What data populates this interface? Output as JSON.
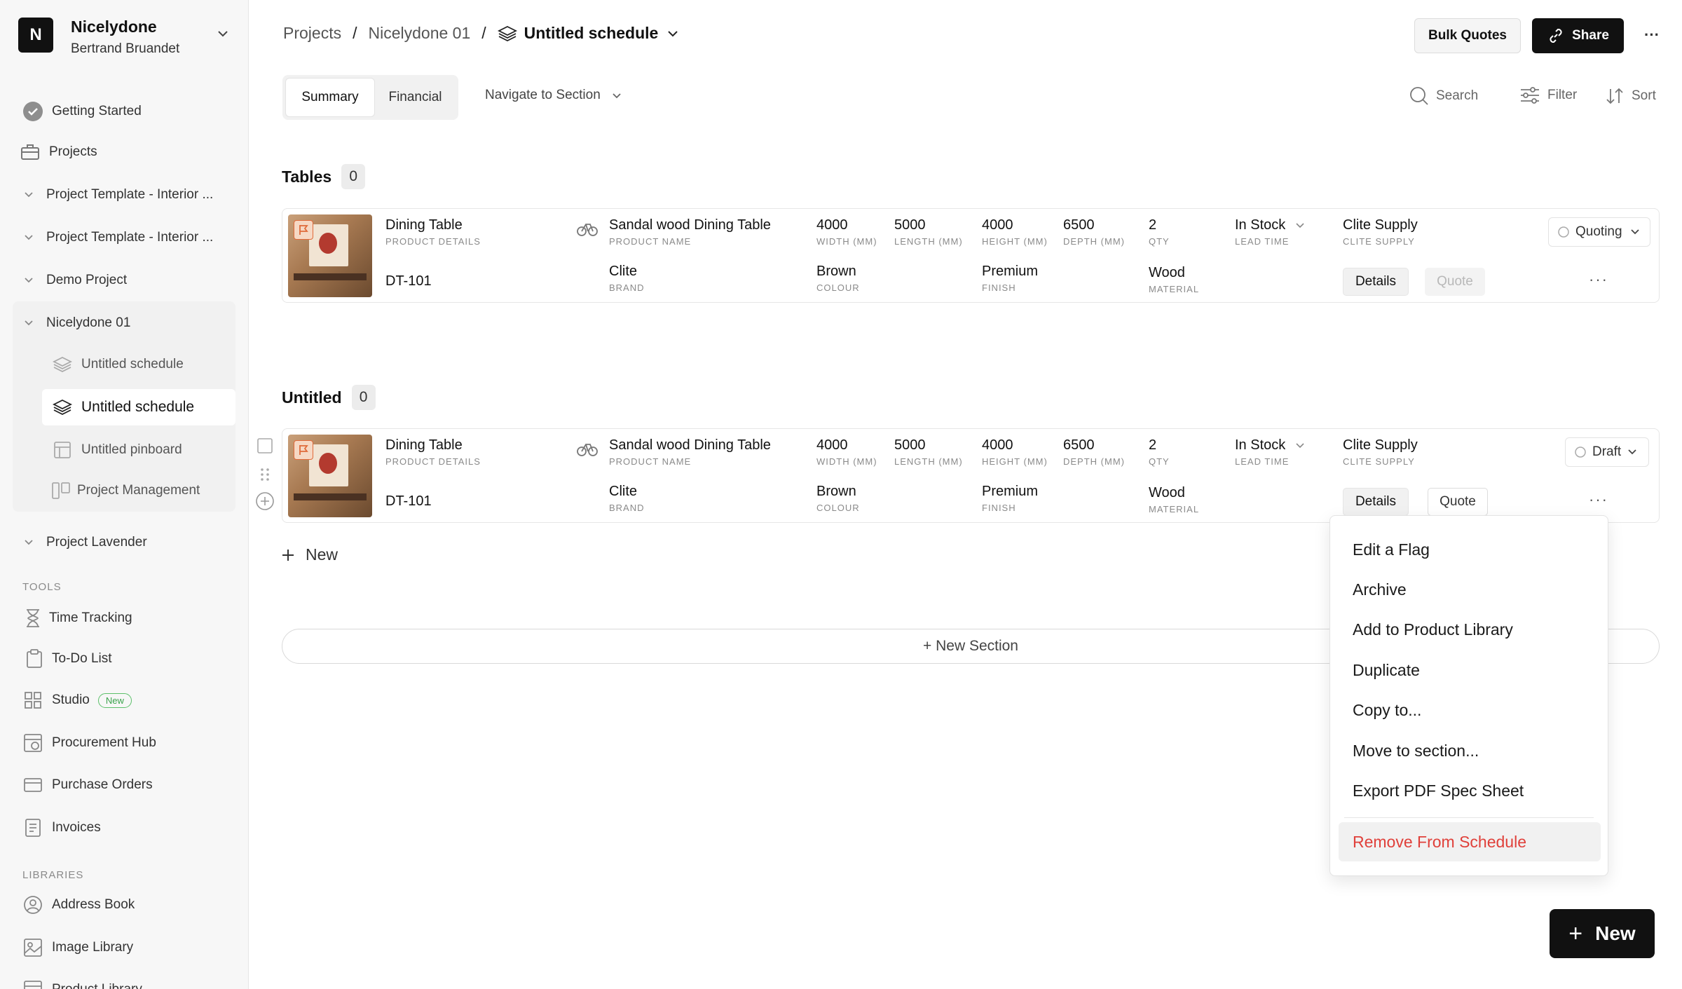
{
  "workspace": {
    "initial": "N",
    "name": "Nicelydone",
    "user": "Bertrand Bruandet"
  },
  "sidebar": {
    "items": [
      {
        "label": "Getting Started"
      },
      {
        "label": "Projects"
      },
      {
        "label": "Project Template - Interior ..."
      },
      {
        "label": "Project Template - Interior ..."
      },
      {
        "label": "Demo Project"
      },
      {
        "label": "Nicelydone 01"
      },
      {
        "label": "Untitled schedule"
      },
      {
        "label": "Untitled schedule"
      },
      {
        "label": "Untitled pinboard"
      },
      {
        "label": "Project Management"
      },
      {
        "label": "Project Lavender"
      }
    ],
    "tools_label": "TOOLS",
    "tools": [
      {
        "label": "Time Tracking"
      },
      {
        "label": "To-Do List"
      },
      {
        "label": "Studio",
        "badge": "New"
      },
      {
        "label": "Procurement Hub"
      },
      {
        "label": "Purchase Orders"
      },
      {
        "label": "Invoices"
      }
    ],
    "libraries_label": "LIBRARIES",
    "libraries": [
      {
        "label": "Address Book"
      },
      {
        "label": "Image Library"
      },
      {
        "label": "Product Library"
      }
    ]
  },
  "breadcrumb": {
    "projects": "Projects",
    "project": "Nicelydone 01",
    "current": "Untitled schedule",
    "sep": "/"
  },
  "header": {
    "bulk_quotes": "Bulk Quotes",
    "share": "Share",
    "more": "···"
  },
  "tabs": [
    {
      "label": "Summary"
    },
    {
      "label": "Financial"
    }
  ],
  "navigate": "Navigate to Section",
  "toolbar": {
    "search": "Search",
    "filter": "Filter",
    "sort": "Sort"
  },
  "sections": [
    {
      "title": "Tables",
      "count": "0",
      "row": {
        "name": "Dining Table",
        "name_lbl": "PRODUCT DETAILS",
        "code": "DT-101",
        "product": "Sandal wood Dining Table",
        "product_lbl": "PRODUCT NAME",
        "brand": "Clite",
        "brand_lbl": "BRAND",
        "width": "4000",
        "width_lbl": "WIDTH (MM)",
        "colour": "Brown",
        "colour_lbl": "COLOUR",
        "length": "5000",
        "length_lbl": "LENGTH (MM)",
        "height": "4000",
        "height_lbl": "HEIGHT (MM)",
        "finish": "Premium",
        "finish_lbl": "FINISH",
        "depth": "6500",
        "depth_lbl": "DEPTH (MM)",
        "qty": "2",
        "qty_lbl": "QTY",
        "material": "Wood",
        "material_lbl": "MATERIAL",
        "lead": "In Stock",
        "lead_lbl": "LEAD TIME",
        "supplier": "Clite Supply",
        "supplier_lbl": "CLITE SUPPLY",
        "status": "Quoting",
        "details": "Details",
        "quote": "Quote",
        "more": "···"
      }
    },
    {
      "title": "Untitled",
      "count": "0",
      "row": {
        "name": "Dining Table",
        "name_lbl": "PRODUCT DETAILS",
        "code": "DT-101",
        "product": "Sandal wood Dining Table",
        "product_lbl": "PRODUCT NAME",
        "brand": "Clite",
        "brand_lbl": "BRAND",
        "width": "4000",
        "width_lbl": "WIDTH (MM)",
        "colour": "Brown",
        "colour_lbl": "COLOUR",
        "length": "5000",
        "length_lbl": "LENGTH (MM)",
        "height": "4000",
        "height_lbl": "HEIGHT (MM)",
        "finish": "Premium",
        "finish_lbl": "FINISH",
        "depth": "6500",
        "depth_lbl": "DEPTH (MM)",
        "qty": "2",
        "qty_lbl": "QTY",
        "material": "Wood",
        "material_lbl": "MATERIAL",
        "lead": "In Stock",
        "lead_lbl": "LEAD TIME",
        "supplier": "Clite Supply",
        "supplier_lbl": "CLITE SUPPLY",
        "status": "Draft",
        "details": "Details",
        "quote": "Quote",
        "more": "···"
      }
    }
  ],
  "new_item": "New",
  "new_section": "+ New Section",
  "context_menu": {
    "items": [
      {
        "label": "Edit a Flag"
      },
      {
        "label": "Archive"
      },
      {
        "label": "Add to Product Library"
      },
      {
        "label": "Duplicate"
      },
      {
        "label": "Copy to..."
      },
      {
        "label": "Move to section..."
      },
      {
        "label": "Export PDF Spec Sheet"
      }
    ],
    "danger": "Remove From Schedule"
  },
  "fab": {
    "label": "New"
  },
  "colors": {
    "accent": "#111111",
    "danger": "#e0403a",
    "badge_green": "#3aa34c"
  }
}
